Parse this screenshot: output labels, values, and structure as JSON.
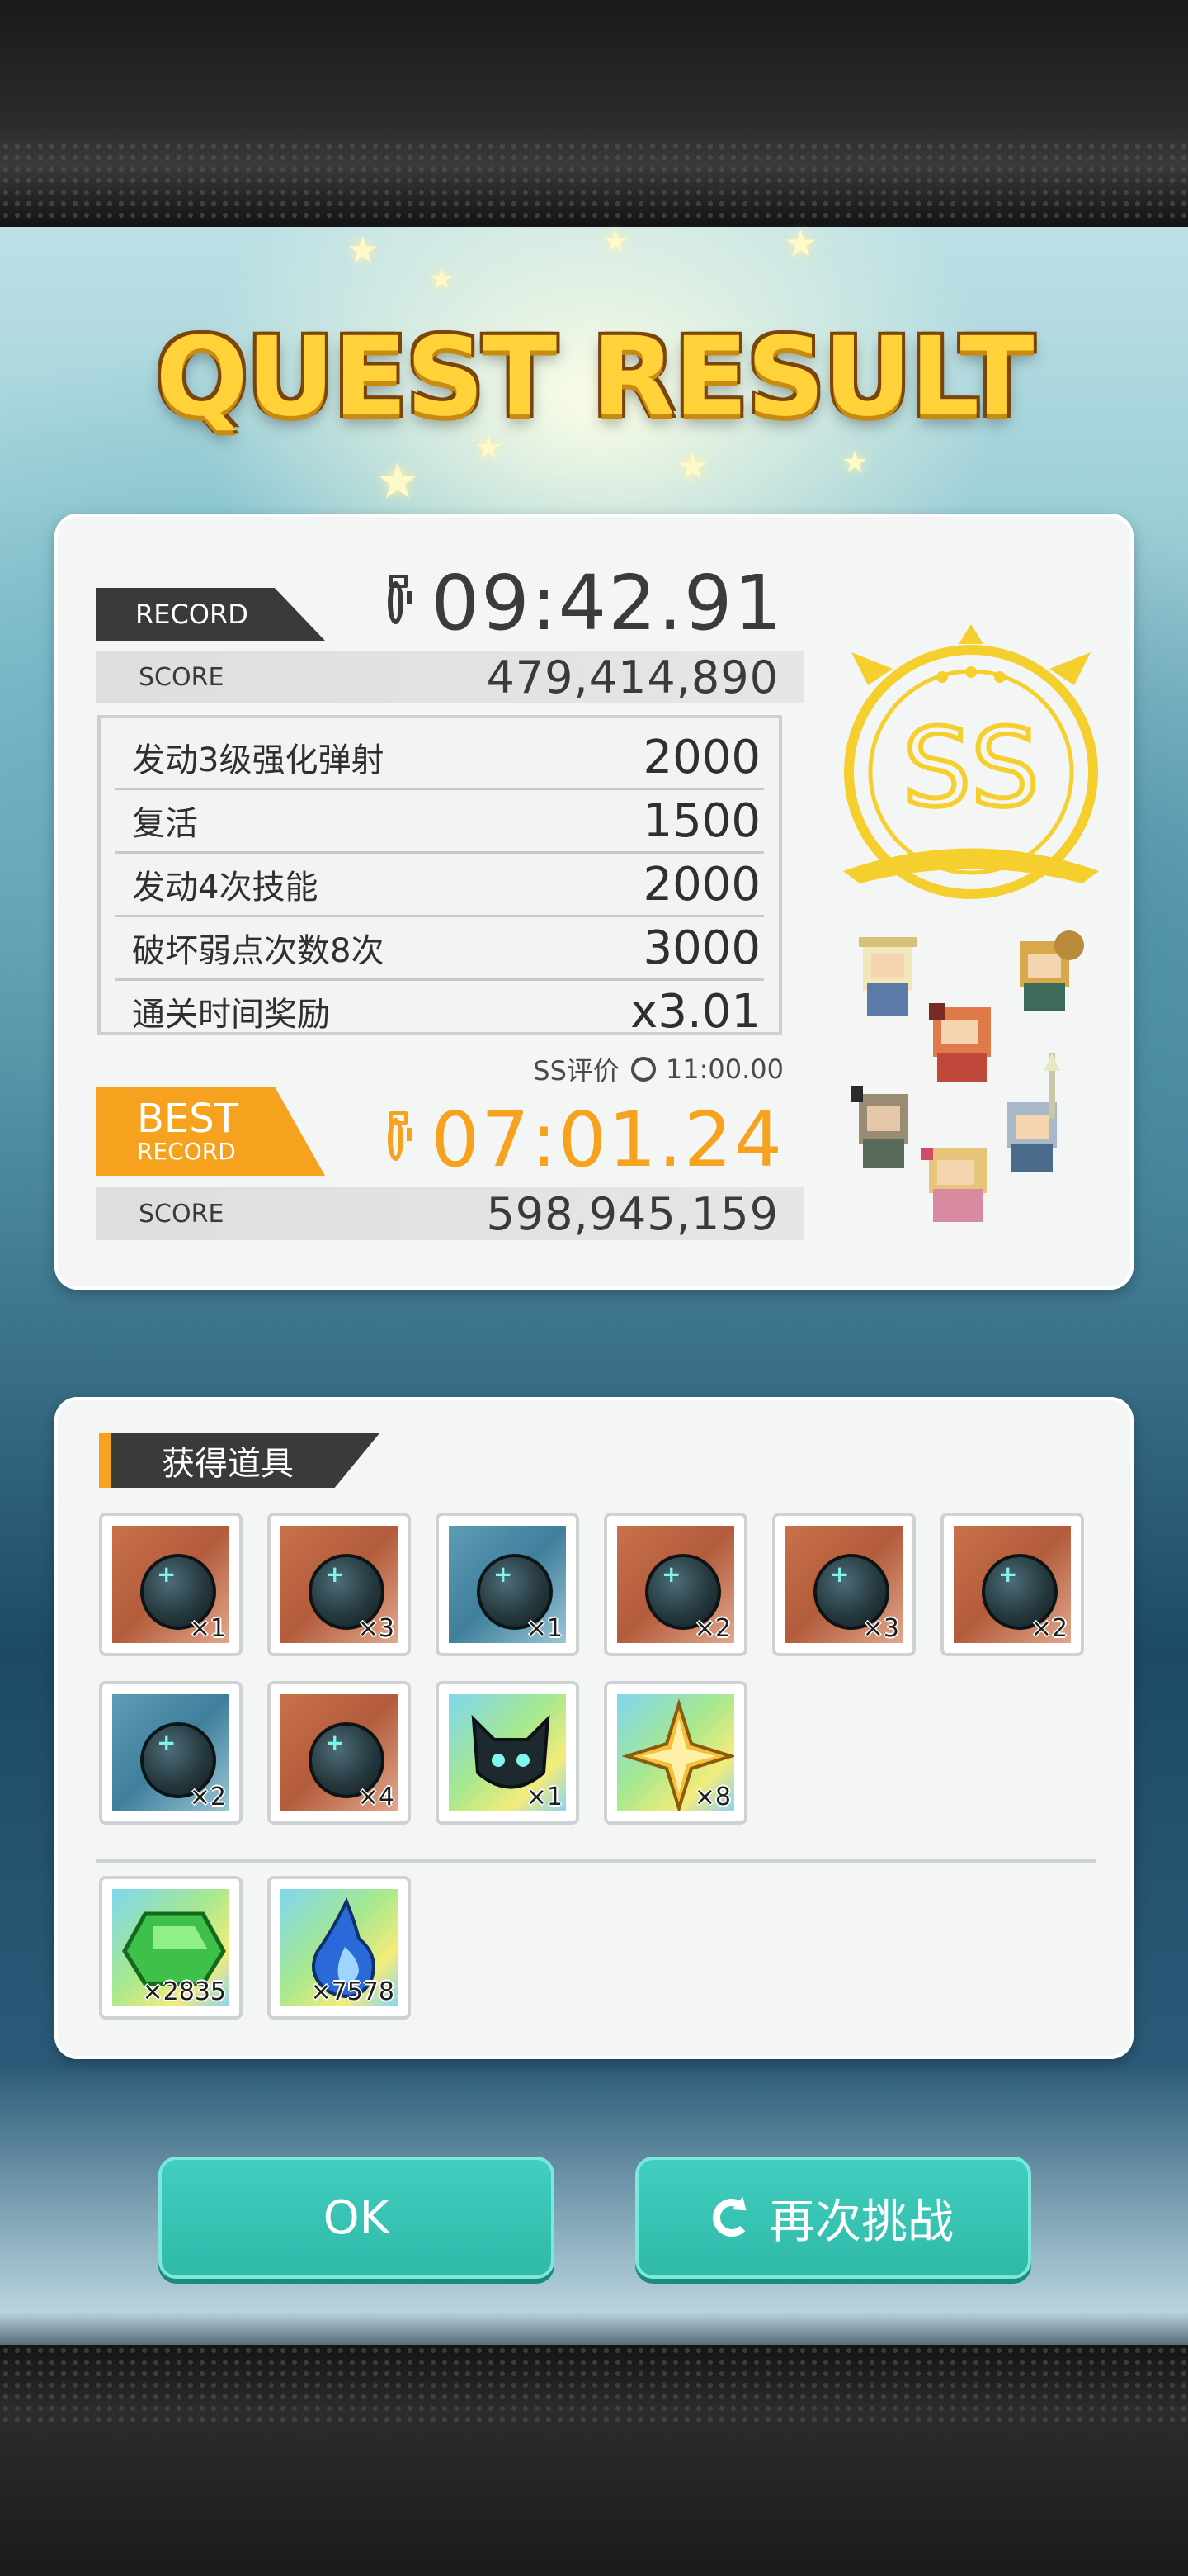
{
  "title": "QUEST RESULT",
  "record": {
    "tag_label": "RECORD",
    "time": "09:42.91",
    "score_label": "SCORE",
    "score": "479,414,890"
  },
  "bonuses": [
    {
      "name": "发动3级强化弹射",
      "value": "2000"
    },
    {
      "name": "复活",
      "value": "1500"
    },
    {
      "name": "发动4次技能",
      "value": "2000"
    },
    {
      "name": "破坏弱点次数8次",
      "value": "3000"
    },
    {
      "name": "通关时间奖励",
      "value": "x3.01"
    }
  ],
  "ss_requirement": {
    "label": "SS评价",
    "time": "11:00.00"
  },
  "best": {
    "tag_line1": "BEST",
    "tag_line2": "RECORD",
    "time": "07:01.24",
    "score_label": "SCORE",
    "score": "598,945,159"
  },
  "rank": {
    "label": "SS",
    "color": "#f5cf2e"
  },
  "items_section": {
    "title": "获得道具"
  },
  "items": [
    {
      "icon": "dark-orb-icon",
      "bg": "brown",
      "qty": "×1"
    },
    {
      "icon": "dark-orb-icon",
      "bg": "brown",
      "qty": "×3"
    },
    {
      "icon": "dark-orb-icon",
      "bg": "blue",
      "qty": "×1"
    },
    {
      "icon": "dark-orb-icon",
      "bg": "brown",
      "qty": "×2"
    },
    {
      "icon": "dark-orb-icon",
      "bg": "brown",
      "qty": "×3"
    },
    {
      "icon": "dark-orb-icon",
      "bg": "brown",
      "qty": "×2"
    },
    {
      "icon": "dark-orb-icon",
      "bg": "blue",
      "qty": "×2"
    },
    {
      "icon": "dark-orb-icon",
      "bg": "brown",
      "qty": "×4"
    },
    {
      "icon": "dark-creature-icon",
      "bg": "rainbow",
      "qty": "×1"
    },
    {
      "icon": "gold-star-icon",
      "bg": "rainbow",
      "qty": "×8"
    }
  ],
  "currencies": [
    {
      "icon": "green-gem-icon",
      "qty": "×2835"
    },
    {
      "icon": "blue-flame-icon",
      "qty": "×7578"
    }
  ],
  "buttons": {
    "ok": "OK",
    "retry": "再次挑战"
  },
  "colors": {
    "accent_orange": "#f7a21e",
    "button_teal": "#35c2b2",
    "title_gold": "#ffd23a"
  }
}
